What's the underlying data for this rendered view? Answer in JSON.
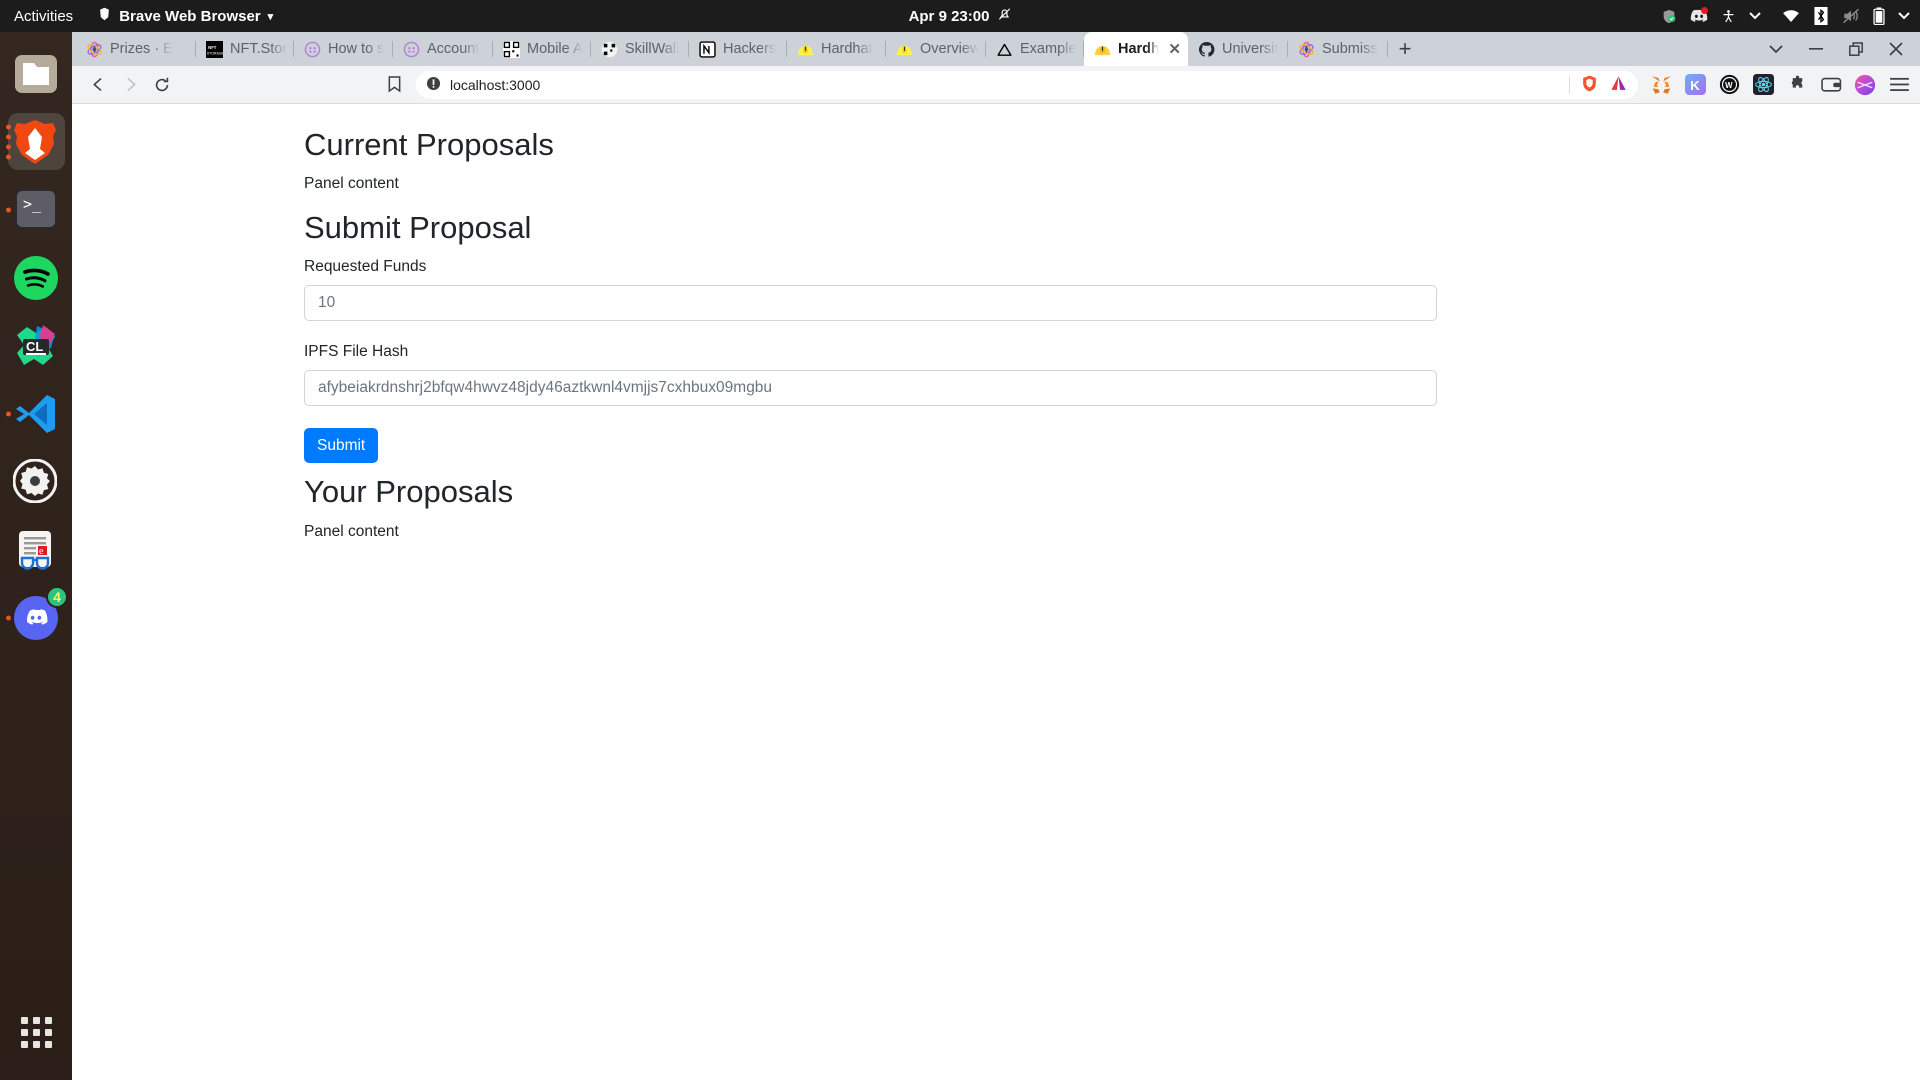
{
  "desktop": {
    "activities_label": "Activities",
    "app_menu": {
      "label": "Brave Web Browser",
      "icon": "brave-lion-icon",
      "chevron": "▾"
    },
    "clock": {
      "datetime": "Apr 9  23:00",
      "icon": "notification-muted-icon"
    },
    "tray_icons": [
      "shield-check-icon",
      "discord-icon",
      "accessibility-icon",
      "chevron-down-icon",
      "wifi-icon",
      "bluetooth-icon",
      "volume-muted-icon",
      "battery-icon",
      "chevron-down-icon"
    ]
  },
  "dock": {
    "items": [
      {
        "name": "files",
        "icon": "files-folder-icon",
        "running_dots": 0,
        "active": false,
        "badge": null
      },
      {
        "name": "brave",
        "icon": "brave-lion-icon",
        "running_dots": 4,
        "active": true,
        "badge": null
      },
      {
        "name": "terminal",
        "icon": "terminal-icon",
        "running_dots": 1,
        "active": false,
        "badge": null
      },
      {
        "name": "spotify",
        "icon": "spotify-icon",
        "running_dots": 0,
        "active": false,
        "badge": null
      },
      {
        "name": "clion",
        "icon": "clion-icon",
        "label": "CL",
        "running_dots": 0,
        "active": false,
        "badge": null
      },
      {
        "name": "vscode",
        "icon": "vscode-icon",
        "running_dots": 1,
        "active": false,
        "badge": null
      },
      {
        "name": "settings",
        "icon": "gear-icon",
        "running_dots": 0,
        "active": false,
        "badge": null
      },
      {
        "name": "news-reader",
        "icon": "news-reader-icon",
        "running_dots": 0,
        "active": false,
        "badge": null
      },
      {
        "name": "discord",
        "icon": "discord-icon",
        "running_dots": 1,
        "active": false,
        "badge": "4"
      }
    ],
    "show_apps_label": "Show Applications"
  },
  "browser": {
    "tabs": [
      {
        "title": "Prizes · E",
        "favicon": "ethglobal-icon",
        "active": false
      },
      {
        "title": "NFT.Stor",
        "favicon": "nftstorage-icon",
        "active": false
      },
      {
        "title": "How to s",
        "favicon": "gitcoin-icon",
        "active": false
      },
      {
        "title": "Account",
        "favicon": "gitcoin-icon",
        "active": false
      },
      {
        "title": "Mobile A",
        "favicon": "qr-icon",
        "active": false
      },
      {
        "title": "SkillWall",
        "favicon": "qr-icon",
        "active": false
      },
      {
        "title": "Hackers",
        "favicon": "notion-icon",
        "active": false
      },
      {
        "title": "Hardhat",
        "favicon": "hardhat-icon",
        "active": false
      },
      {
        "title": "Overview",
        "favicon": "hardhat-icon",
        "active": false
      },
      {
        "title": "Example",
        "favicon": "vercel-icon",
        "active": false
      },
      {
        "title": "Hardh",
        "favicon": "hardhat-icon",
        "active": true,
        "close_label": "✕"
      },
      {
        "title": "Universit",
        "favicon": "github-icon",
        "active": false
      },
      {
        "title": "Submiss",
        "favicon": "ethglobal-icon",
        "active": false
      }
    ],
    "new_tab_label": "+",
    "window_controls": {
      "tab_search": "chevron-down-icon",
      "minimize": "minimize-icon",
      "maximize": "restore-icon",
      "close": "close-icon"
    },
    "toolbar": {
      "back": "back-arrow-icon",
      "forward": "forward-arrow-icon",
      "reload": "reload-icon",
      "bookmark": "bookmark-icon",
      "url_security_icon": "not-secure-icon",
      "url": "localhost:3000",
      "brave_shields_icon": "brave-shields-icon",
      "brave_rewards_icon": "brave-rewards-triangle-icon",
      "extensions": [
        "metamask-icon",
        "keplr-icon",
        "wallet-w-icon",
        "react-devtools-icon",
        "puzzle-extensions-icon",
        "wallet-card-icon",
        "brave-profile-icon",
        "hamburger-menu-icon"
      ]
    }
  },
  "page": {
    "current_proposals_heading": "Current Proposals",
    "current_proposals_panel": "Panel content",
    "submit_proposal_heading": "Submit Proposal",
    "requested_funds_label": "Requested Funds",
    "requested_funds_value": "10",
    "ipfs_hash_label": "IPFS File Hash",
    "ipfs_hash_value": "afybeiakrdnshrj2bfqw4hwvz48jdy46aztkwnl4vmjjs7cxhbux09mgbu",
    "submit_button": "Submit",
    "your_proposals_heading": "Your Proposals",
    "your_proposals_panel": "Panel content"
  },
  "colors": {
    "primary_button": "#007bff",
    "topbar_bg": "#1c1c1c",
    "dock_bg": "#2d2019",
    "tabstrip_bg": "#cdd2d8",
    "toolbar_bg": "#f1f3f4",
    "badge_green": "#2ec27e",
    "ubuntu_orange": "#e95420"
  }
}
